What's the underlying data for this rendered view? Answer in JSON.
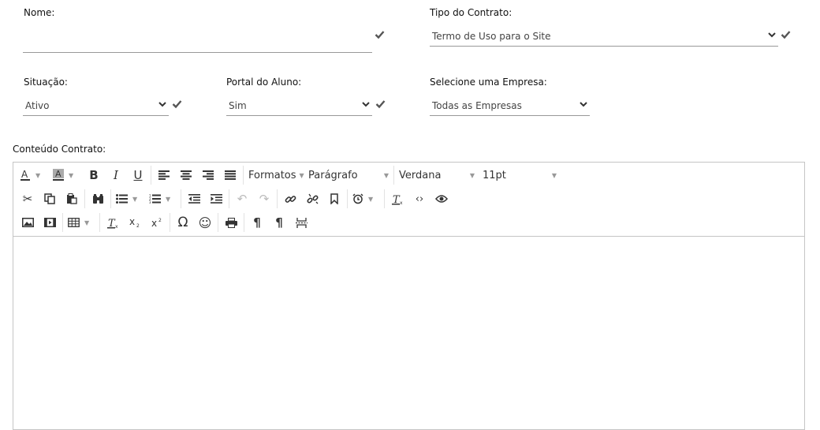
{
  "form": {
    "nome": {
      "label": "Nome:",
      "value": ""
    },
    "tipo_contrato": {
      "label": "Tipo do Contrato:",
      "value": "Termo de Uso para o Site"
    },
    "situacao": {
      "label": "Situação:",
      "value": "Ativo"
    },
    "portal_aluno": {
      "label": "Portal do Aluno:",
      "value": "Sim"
    },
    "empresa": {
      "label": "Selecione uma Empresa:",
      "value": "Todas as Empresas"
    },
    "conteudo": {
      "label": "Conteúdo Contrato:"
    }
  },
  "editor": {
    "formats_label": "Formatos",
    "block_label": "Parágrafo",
    "font_label": "Verdana",
    "size_label": "11pt"
  },
  "colors": {
    "check": "#555555",
    "border": "#c5c5c5",
    "underline": "#999999"
  }
}
